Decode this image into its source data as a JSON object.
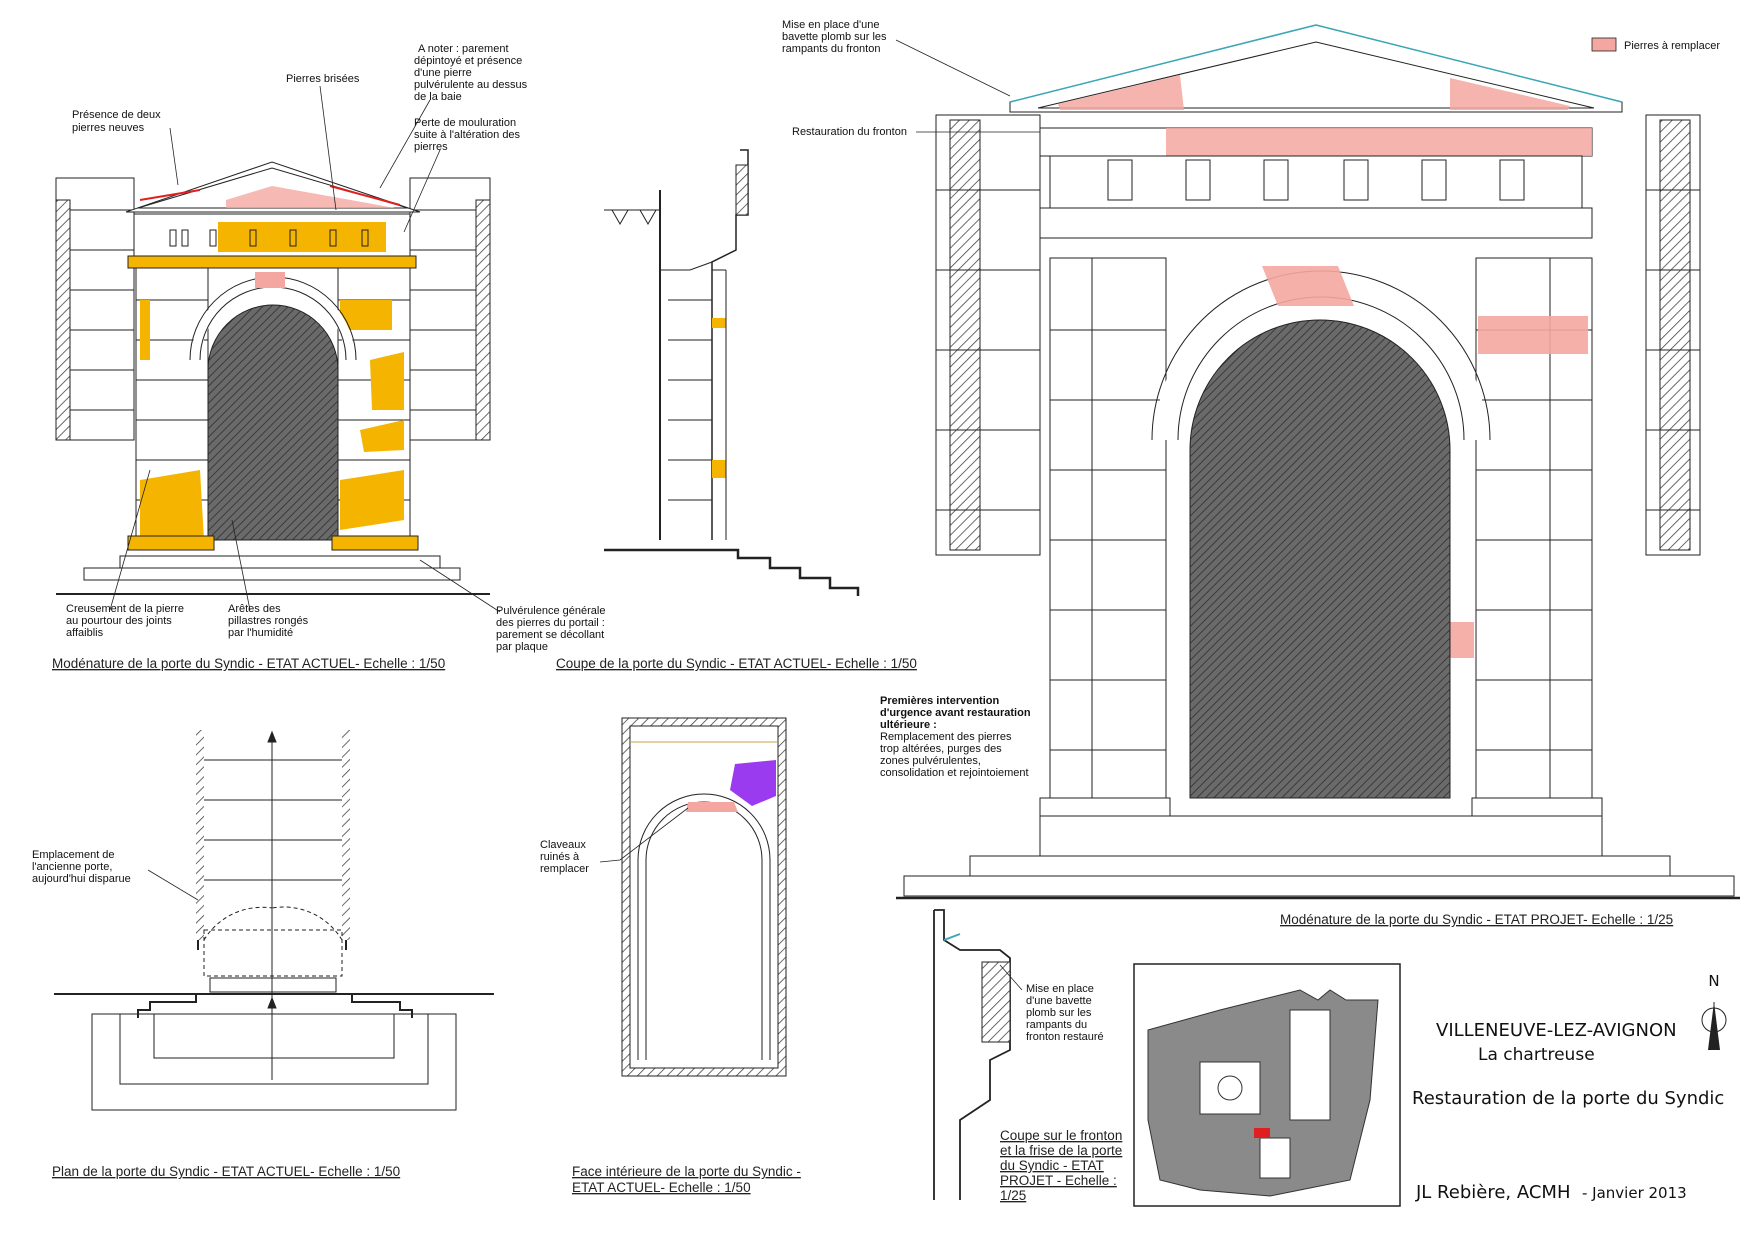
{
  "colors": {
    "degraded": "#f5b400",
    "replace": "#f4a7a0",
    "purple": "#9b3bf0",
    "line": "#222222",
    "red": "#e02020"
  },
  "legend": {
    "label": "Pierres à remplacer"
  },
  "annotations": {
    "presence": [
      "Présence de deux",
      "pierres neuves"
    ],
    "brisees": [
      "Pierres brisées"
    ],
    "anoter": [
      "A noter : parement",
      "dépintoyé et présence",
      "d'une pierre",
      "pulvérulente au dessus",
      "de la baie"
    ],
    "perte": [
      "Perte de mouluration",
      "suite à l'altération des",
      "pierres"
    ],
    "creusement": [
      "Creusement de la pierre",
      "au pourtour des joints",
      "affaiblis"
    ],
    "aretes": [
      "Arêtes des",
      "pillastres rongés",
      "par l'humidité"
    ],
    "pulverulence": [
      "Pulvérulence générale",
      "des pierres du portail :",
      "parement se décollant",
      "par plaque"
    ],
    "bavette": [
      "Mise en place d'une",
      "bavette plomb sur les",
      "rampants du fronton"
    ],
    "restauration_fronton": "Restauration du fronton",
    "emplacement": [
      "Emplacement de",
      "l'ancienne porte,",
      "aujourd'hui disparue"
    ],
    "claveaux": [
      "Claveaux",
      "ruinés à",
      "remplacer"
    ],
    "premieres_bold": [
      "Premières intervention",
      "d'urgence avant restauration",
      "ultérieure :"
    ],
    "premieres": [
      "Remplacement des pierres",
      "trop altérées, purges des",
      "zones pulvérulentes,",
      "consolidation et rejointoiement"
    ],
    "bavette2": [
      "Mise en place",
      "d'une bavette",
      "plomb sur les",
      "rampants du",
      "fronton restauré"
    ]
  },
  "captions": {
    "modenature_actuel": "Modénature de la porte du Syndic - ETAT ACTUEL- Echelle : 1/50",
    "coupe_actuel": "Coupe de la porte du Syndic - ETAT ACTUEL- Echelle : 1/50",
    "modenature_projet": "Modénature de la porte du Syndic - ETAT PROJET- Echelle : 1/25",
    "plan_actuel": "Plan de la porte du Syndic - ETAT ACTUEL- Echelle : 1/50",
    "face": [
      "Face intérieure de la porte du Syndic -",
      "ETAT ACTUEL- Echelle : 1/50"
    ],
    "coupe_fronton": [
      "Coupe sur le fronton",
      "et la frise de la porte",
      "du Syndic - ETAT",
      "PROJET - Echelle :",
      "1/25"
    ]
  },
  "title_block": {
    "city": "VILLENEUVE-LEZ-AVIGNON",
    "site": "La chartreuse",
    "project": "Restauration de la porte du Syndic",
    "author": "JL Rebière, ACMH",
    "date": "- Janvier 2013",
    "north": "N"
  }
}
